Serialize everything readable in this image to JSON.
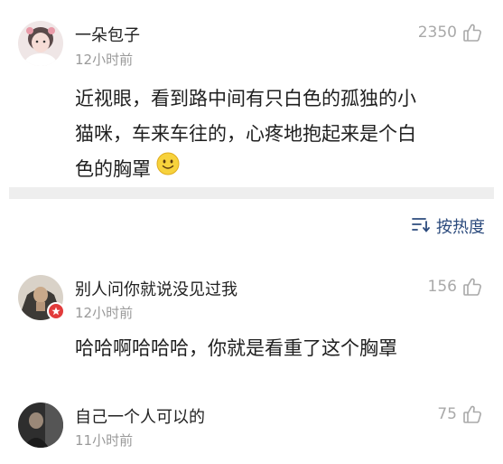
{
  "comments": [
    {
      "username": "一朵包子",
      "time": "12小时前",
      "likes": "2350",
      "text_lines": [
        "近视眼，看到路中间有只白色的孤独的小",
        "猫咪，车来车往的，心疼地抱起来是个白",
        "色的胸罩"
      ],
      "emoji": "smiley-emoji"
    },
    {
      "username": "别人问你就说没见过我",
      "time": "12小时前",
      "likes": "156",
      "text_lines": [
        "哈哈啊哈哈哈，你就是看重了这个胸罩"
      ]
    },
    {
      "username": "自己一个人可以的",
      "time": "11小时前",
      "likes": "75"
    }
  ],
  "sort": {
    "label": "按热度",
    "icon": "sort-icon"
  },
  "colors": {
    "link_blue": "#2c4b7d",
    "meta_gray": "#9a9a9a",
    "divider": "#eeeeee"
  }
}
